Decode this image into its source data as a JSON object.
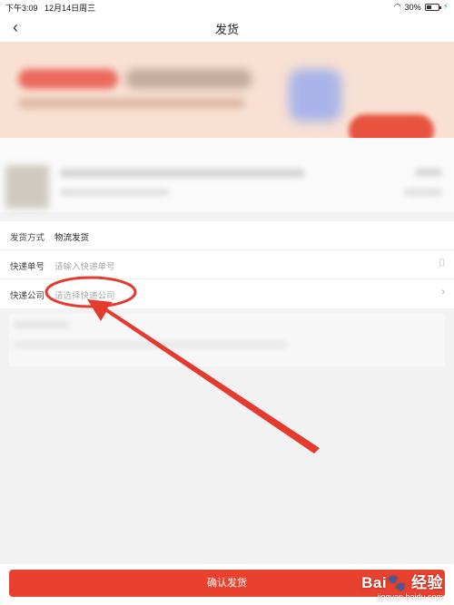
{
  "status_bar": {
    "time": "下午3:09",
    "date": "12月14日周三",
    "battery": "30%"
  },
  "nav": {
    "back_icon": "chevron-left-icon",
    "title": "发货"
  },
  "form": {
    "method_label": "发货方式",
    "method_value": "物流发货",
    "tracking_label": "快递单号",
    "tracking_placeholder": "请输入快递单号",
    "company_label": "快递公司",
    "company_placeholder": "请选择快递公司"
  },
  "footer": {
    "confirm_label": "确认发货"
  },
  "watermark": {
    "brand": "Bai🐾 经验",
    "url": "jingyan.baidu.com"
  },
  "annotation": {
    "color": "#e53b2f"
  }
}
